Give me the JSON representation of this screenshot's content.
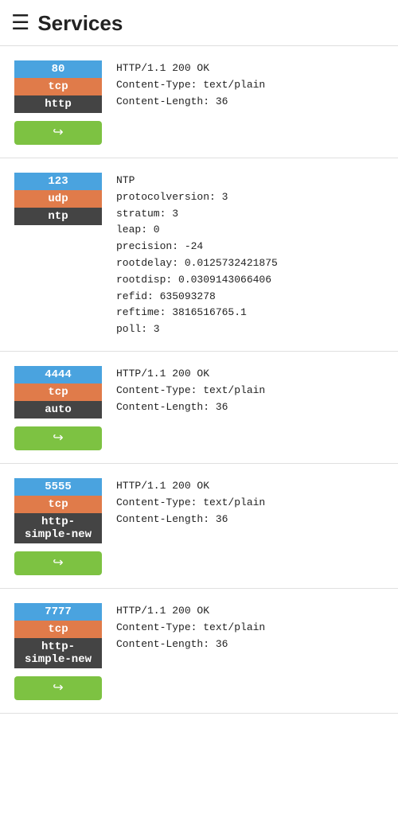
{
  "header": {
    "title": "Services",
    "icon": "☰"
  },
  "services": [
    {
      "id": "service-80",
      "port": "80",
      "proto": "tcp",
      "service": "http",
      "info": "HTTP/1.1 200 OK\nContent-Type: text/plain\nContent-Length: 36",
      "has_redirect": true
    },
    {
      "id": "service-123",
      "port": "123",
      "proto": "udp",
      "service": "ntp",
      "info": "NTP\nprotocolversion: 3\nstratum: 3\nleap: 0\nprecision: -24\nrootdelay: 0.0125732421875\nrootdisp: 0.0309143066406\nrefid: 635093278\nreftime: 3816516765.1\npoll: 3",
      "has_redirect": false
    },
    {
      "id": "service-4444",
      "port": "4444",
      "proto": "tcp",
      "service": "auto",
      "info": "HTTP/1.1 200 OK\nContent-Type: text/plain\nContent-Length: 36",
      "has_redirect": true
    },
    {
      "id": "service-5555",
      "port": "5555",
      "proto": "tcp",
      "service": "http-simple-new",
      "info": "HTTP/1.1 200 OK\nContent-Type: text/plain\nContent-Length: 36",
      "has_redirect": true
    },
    {
      "id": "service-7777",
      "port": "7777",
      "proto": "tcp",
      "service": "http-simple-new",
      "info": "HTTP/1.1 200 OK\nContent-Type: text/plain\nContent-Length: 36",
      "has_redirect": true
    }
  ],
  "redirect_button_label": "↪"
}
